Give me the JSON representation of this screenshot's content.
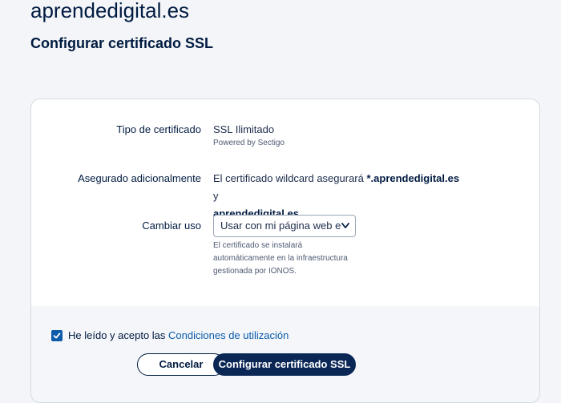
{
  "header": {
    "domain": "aprendedigital.es",
    "subtitle": "Configurar certificado SSL"
  },
  "form": {
    "cert_type": {
      "label": "Tipo de certificado",
      "value": "SSL Ilimitado",
      "hint": "Powered by Sectigo"
    },
    "secured": {
      "label": "Asegurado adicionalmente",
      "text_before": "El certificado wildcard asegurará ",
      "wildcard_domain": "*.aprendedigital.es",
      "text_and": " y",
      "base_domain": "aprendedigital.es"
    },
    "usage": {
      "label": "Cambiar uso",
      "selected": "Usar con mi página web en IONOS",
      "hint_line1": "El certificado se instalará",
      "hint_line2": "automáticamente en la infraestructura",
      "hint_line3": "gestionada por IONOS."
    }
  },
  "footer": {
    "accept_text": "He leído y acepto las ",
    "terms_link": "Condiciones de utilización",
    "checked": true,
    "cancel_label": "Cancelar",
    "submit_label": "Configurar certificado SSL"
  },
  "colors": {
    "primary": "#0a2756",
    "link": "#0b5cab",
    "text": "#001b41"
  }
}
